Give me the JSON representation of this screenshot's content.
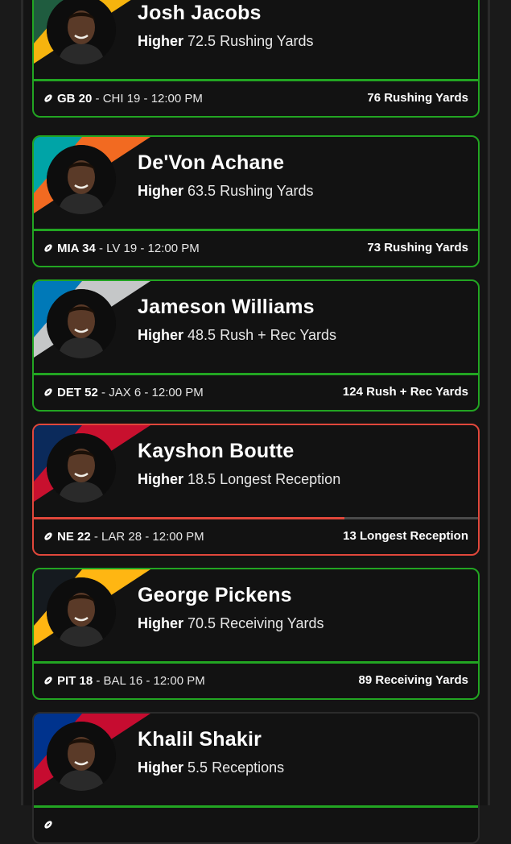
{
  "cards": [
    {
      "player": "Josh Jacobs",
      "pick_direction": "Higher",
      "line": "72.5",
      "stat": "Rushing Yards",
      "team": "GB",
      "team_score": "20",
      "opponent_line": "CHI 19 - 12:00 PM",
      "result": "76 Rushing Yards",
      "status": "win",
      "team_colors": [
        "#1f5c3f",
        "#f6b40e"
      ]
    },
    {
      "player": "De'Von Achane",
      "pick_direction": "Higher",
      "line": "63.5",
      "stat": "Rushing Yards",
      "team": "MIA",
      "team_score": "34",
      "opponent_line": "LV 19 - 12:00 PM",
      "result": "73 Rushing Yards",
      "status": "win",
      "team_colors": [
        "#00a4a7",
        "#f26a21"
      ]
    },
    {
      "player": "Jameson Williams",
      "pick_direction": "Higher",
      "line": "48.5",
      "stat": "Rush + Rec Yards",
      "team": "DET",
      "team_score": "52",
      "opponent_line": "JAX 6 - 12:00 PM",
      "result": "124 Rush + Rec Yards",
      "status": "win",
      "team_colors": [
        "#0079b8",
        "#c5c7c8"
      ]
    },
    {
      "player": "Kayshon Boutte",
      "pick_direction": "Higher",
      "line": "18.5",
      "stat": "Longest Reception",
      "team": "NE",
      "team_score": "22",
      "opponent_line": "LAR 28 - 12:00 PM",
      "result": "13 Longest Reception",
      "status": "loss",
      "progress": 0.7,
      "team_colors": [
        "#0b2a5b",
        "#c8102e"
      ]
    },
    {
      "player": "George Pickens",
      "pick_direction": "Higher",
      "line": "70.5",
      "stat": "Receiving Yards",
      "team": "PIT",
      "team_score": "18",
      "opponent_line": "BAL 16 - 12:00 PM",
      "result": "89 Receiving Yards",
      "status": "win",
      "team_colors": [
        "#151a1f",
        "#ffb612"
      ]
    },
    {
      "player": "Khalil Shakir",
      "pick_direction": "Higher",
      "line": "5.5",
      "stat": "Receptions",
      "team": "",
      "team_score": "",
      "opponent_line": "",
      "result": "",
      "status": "pending",
      "team_colors": [
        "#00338d",
        "#c60c30"
      ]
    }
  ],
  "colors": {
    "win": "#22a522",
    "loss": "#e0473b",
    "background": "#141414"
  },
  "icons": {
    "game": "football-icon"
  }
}
